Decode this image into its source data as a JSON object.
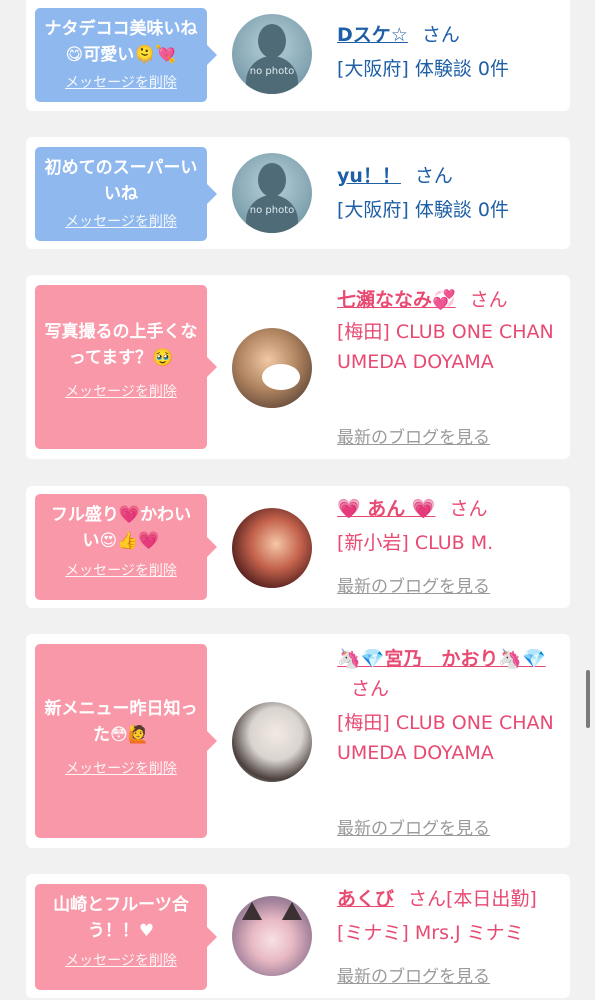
{
  "messages": [
    {
      "bubble_text": "ナタデココ美味いね😋可愛い🫠💘",
      "delete_label": "メッセージを削除",
      "name": "Dスケ☆",
      "honorific": "さん",
      "info": "[大阪府] 体験談 0件",
      "avatar_caption": "no photo",
      "type": "user"
    },
    {
      "bubble_text": "初めてのスーパーいいね",
      "delete_label": "メッセージを削除",
      "name": "yu！！",
      "honorific": "さん",
      "info": "[大阪府] 体験談 0件",
      "avatar_caption": "no photo",
      "type": "user"
    },
    {
      "bubble_text": "写真撮るの上手くなってます？🥹",
      "delete_label": "メッセージを削除",
      "name": "七瀬ななみ💞",
      "honorific": "さん",
      "info": "[梅田] CLUB ONE CHAN UMEDA DOYAMA",
      "blog_label": "最新のブログを見る",
      "type": "cast"
    },
    {
      "bubble_text": "フル盛り💗かわいい😍👍💗",
      "delete_label": "メッセージを削除",
      "name": "💗 あん 💗",
      "honorific": "さん",
      "info": "[新小岩] CLUB M.",
      "blog_label": "最新のブログを見る",
      "type": "cast"
    },
    {
      "bubble_text": "新メニュー昨日知った😳🙋",
      "delete_label": "メッセージを削除",
      "name": "🦄💎宮乃　かおり🦄💎",
      "honorific": "さん",
      "info": "[梅田] CLUB ONE CHAN UMEDA DOYAMA",
      "blog_label": "最新のブログを見る",
      "type": "cast"
    },
    {
      "bubble_text": "山崎とフルーツ合う！！♥",
      "delete_label": "メッセージを削除",
      "name": "あくび",
      "honorific": "さん[本日出勤]",
      "info": "[ミナミ] Mrs.J ミナミ",
      "blog_label": "最新のブログを見る",
      "type": "cast"
    }
  ],
  "colors": {
    "user_bubble": "#8eb8ee",
    "cast_bubble": "#f898a8",
    "user_text": "#1e5fa6",
    "cast_text": "#e84a72",
    "background": "#f1f1f1"
  }
}
